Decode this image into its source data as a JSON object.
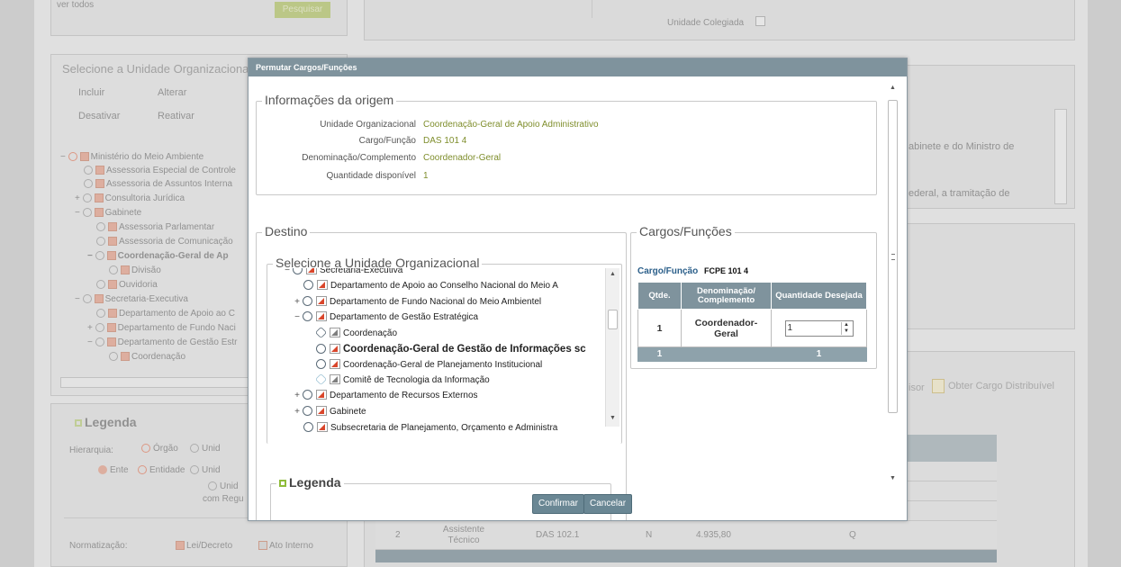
{
  "background": {
    "top_left_link": "ver todos",
    "top_green_button": "Pesquisar",
    "unidade_colegiada": "Unidade Colegiada",
    "select_unit_title": "Selecione a Unidade Organizacional",
    "toolbar": [
      "Incluir",
      "Alterar",
      "Desativar",
      "Reativar"
    ],
    "tree": [
      "Ministério do Meio Ambiente",
      "Assessoria Especial de Controle",
      "Assessoria de Assuntos Interna",
      "Consultoria Jurídica",
      "Gabinete",
      "Assessoria Parlamentar",
      "Assessoria de Comunicação",
      "Coordenação-Geral de Ap",
      "Divisão",
      "Ouvidoria",
      "Secretaria-Executiva",
      "Departamento de Apoio ao C",
      "Departamento de Fundo Naci",
      "Departamento de Gestão Estr",
      "Coordenação"
    ],
    "right_text_1": "abinete e do Ministro de",
    "right_text_2": "ederal, a tramitação de",
    "right_link_1": "isor",
    "right_link_2": "Obter Cargo Distribuível",
    "legend_title": "Legenda",
    "legend_hierarquia": "Hierarquia:",
    "legend_orgao": "Órgão",
    "legend_unid": "Unid",
    "legend_ente": "Ente",
    "legend_entidade": "Entidade",
    "legend_unid2": "Unid",
    "legend_unid3": "Unid",
    "legend_com_regu": "com Regu",
    "normatizacao": "Normatização:",
    "lei_decreto": "Lei/Decreto",
    "ato_interno": "Ato Interno",
    "table_row": {
      "n": "2",
      "cargo": "Assistente Técnico",
      "codigo": "DAS 102.1",
      "tipo": "N",
      "valor": "4.935,80",
      "q": "Q"
    }
  },
  "modal": {
    "title": "Permutar Cargos/Funções",
    "origem": {
      "legend": "Informações da origem",
      "fields": [
        {
          "label": "Unidade Organizacional",
          "value": "Coordenação-Geral de Apoio Administrativo"
        },
        {
          "label": "Cargo/Função",
          "value": "DAS 101 4"
        },
        {
          "label": "Denominação/Complemento",
          "value": "Coordenador-Geral"
        },
        {
          "label": "Quantidade disponível",
          "value": "1"
        }
      ]
    },
    "destino": {
      "legend": "Destino",
      "select_legend": "Selecione a Unidade Organizacional",
      "tree": [
        {
          "label": "Secretaria-Executiva",
          "indent": 0,
          "toggle": "−",
          "flag": "red"
        },
        {
          "label": "Departamento de Apoio ao Conselho Nacional do Meio A",
          "indent": 1,
          "toggle": "",
          "flag": "red"
        },
        {
          "label": "Departamento de Fundo Nacional do Meio Ambientel",
          "indent": 1,
          "toggle": "+",
          "flag": "red"
        },
        {
          "label": "Departamento de Gestão Estratégica",
          "indent": 1,
          "toggle": "−",
          "flag": "red"
        },
        {
          "label": "Coordenação",
          "indent": 2,
          "toggle": "",
          "flag": "gray"
        },
        {
          "label": "Coordenação-Geral de Gestão de Informações sc",
          "indent": 2,
          "toggle": "",
          "flag": "red",
          "selected": true
        },
        {
          "label": "Coordenação-Geral de Planejamento Institucional",
          "indent": 2,
          "toggle": "",
          "flag": "red"
        },
        {
          "label": "Comitê de Tecnologia da Informação",
          "indent": 2,
          "toggle": "",
          "flag": "gray",
          "light": true
        },
        {
          "label": "Departamento de Recursos Externos",
          "indent": 1,
          "toggle": "+",
          "flag": "red"
        },
        {
          "label": "Gabinete",
          "indent": 1,
          "toggle": "+",
          "flag": "red"
        },
        {
          "label": "Subsecretaria de Planejamento, Orçamento e Administra",
          "indent": 1,
          "toggle": "",
          "flag": "red"
        }
      ],
      "legend_box": "Legenda"
    },
    "cargos": {
      "legend": "Cargos/Funções",
      "cargo_label": "Cargo/Função",
      "cargo_value": "FCPE 101 4",
      "headers": [
        "Qtde.",
        "Denominação/ Complemento",
        "Quantidade Desejada"
      ],
      "row": {
        "qtde": "1",
        "denominacao": "Coordenador-Geral",
        "desejada": "1"
      },
      "footer": {
        "qtde": "1",
        "desejada": "1"
      }
    },
    "buttons": {
      "confirm": "Confirmar",
      "cancel": "Cancelar"
    }
  }
}
